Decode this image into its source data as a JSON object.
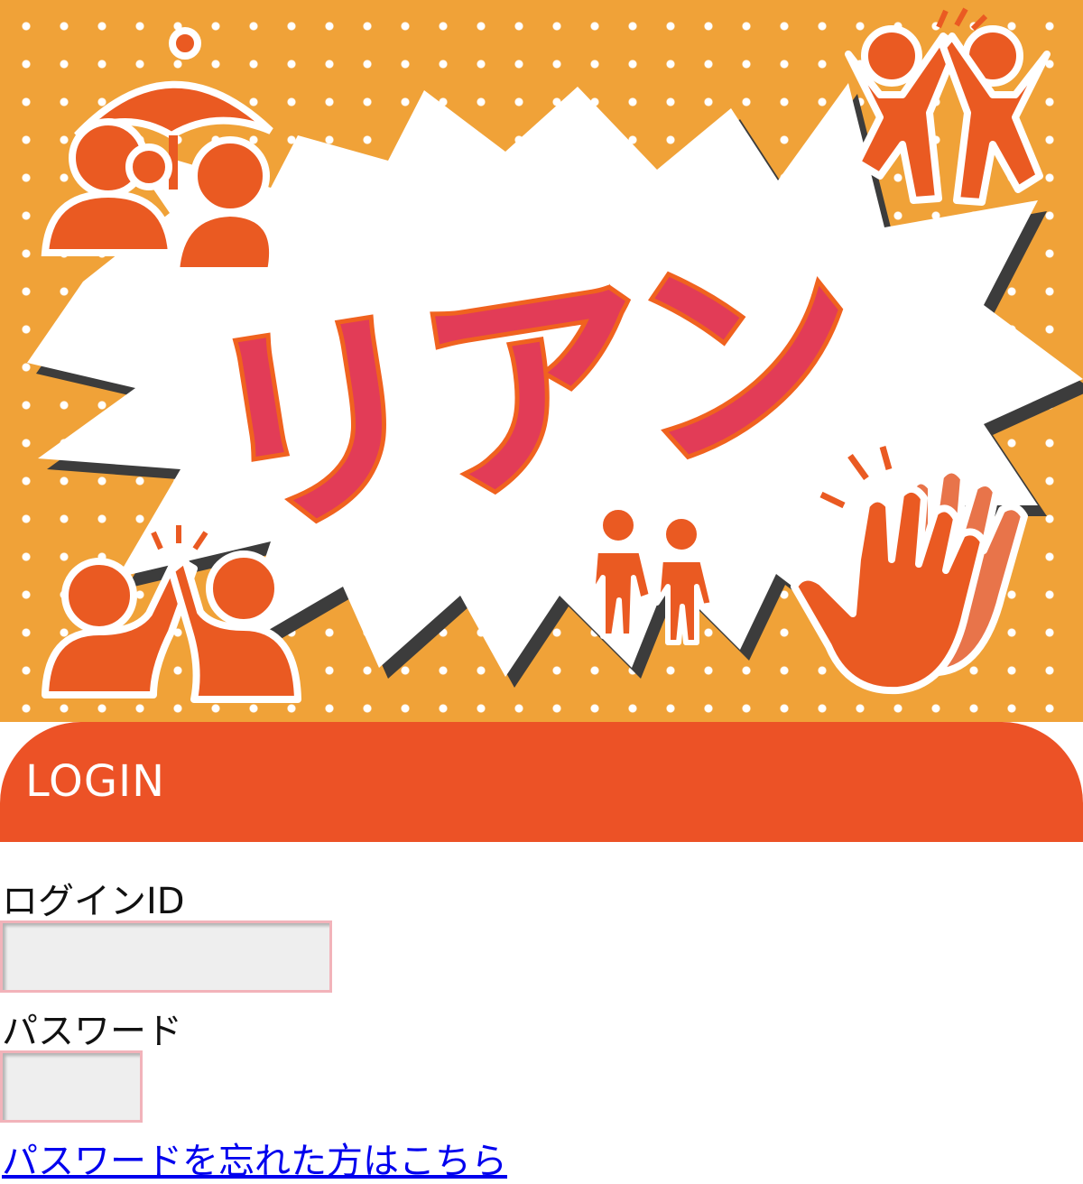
{
  "banner": {
    "logo_text": "リアン",
    "icons": [
      "couple-umbrella-icon",
      "jumping-high-five-icon",
      "high-five-icon",
      "holding-hands-icon",
      "clapping-hands-icon"
    ],
    "colors": {
      "background": "#f0a238",
      "dots": "#ffffff",
      "figures": "#ea5a22",
      "logo": "#e23c57",
      "logo_outline": "#f0621f"
    }
  },
  "login": {
    "header_label": "LOGIN",
    "header_color": "#ec5226",
    "id_label": "ログインID",
    "id_value": "",
    "password_label": "パスワード",
    "password_value": "",
    "forgot_link": "パスワードを忘れた方はこちら"
  }
}
